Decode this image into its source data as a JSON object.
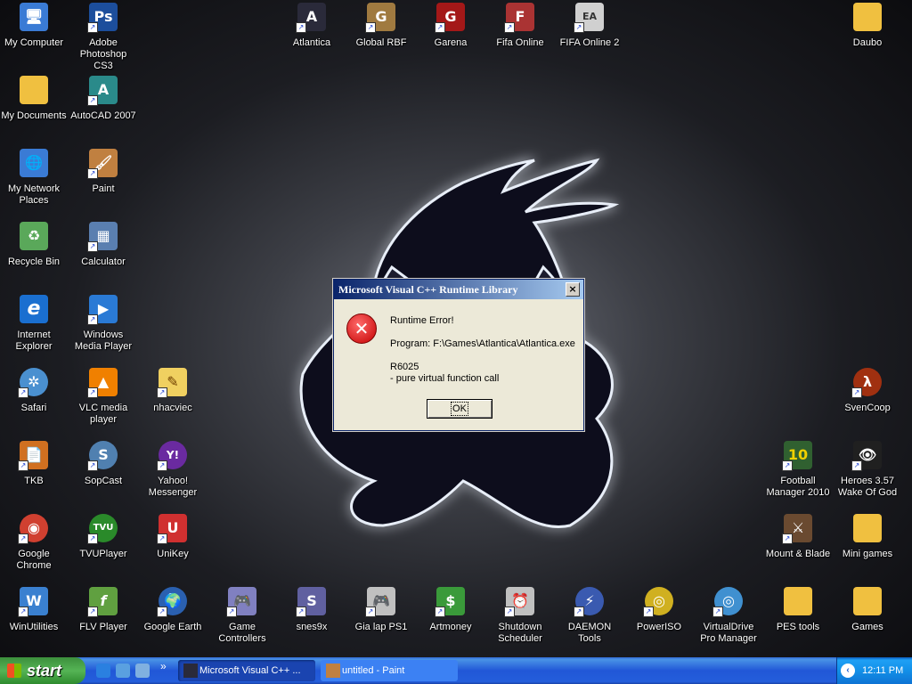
{
  "desktop": {
    "icons": [
      {
        "label": "My Computer",
        "icon": "my-computer-icon",
        "color": "#3a7bd5",
        "glyph": "🖥"
      },
      {
        "label": "Adobe Photoshop CS3",
        "icon": "photoshop-icon",
        "color": "#1c4e9c",
        "glyph": "Ps"
      },
      {
        "label": "Atlantica",
        "icon": "atlantica-icon",
        "color": "#2a2a3a",
        "glyph": "A"
      },
      {
        "label": "Global RBF",
        "icon": "global-rbf-icon",
        "color": "#a07a40",
        "glyph": "G"
      },
      {
        "label": "Garena",
        "icon": "garena-icon",
        "color": "#a41818",
        "glyph": "G"
      },
      {
        "label": "Fifa Online",
        "icon": "fifa-online-icon",
        "color": "#aa3333",
        "glyph": "F"
      },
      {
        "label": "FIFA Online 2",
        "icon": "fifa-online-2-icon",
        "color": "#d0d0d0",
        "glyph": "EA"
      },
      {
        "label": "Daubo",
        "icon": "folder-icon",
        "color": "#f0c040",
        "glyph": ""
      },
      {
        "label": "My Documents",
        "icon": "my-documents-icon",
        "color": "#f0c040",
        "glyph": ""
      },
      {
        "label": "AutoCAD 2007",
        "icon": "autocad-icon",
        "color": "#2a8a8a",
        "glyph": "A"
      },
      {
        "label": "My Network Places",
        "icon": "network-places-icon",
        "color": "#3a7bd5",
        "glyph": "🌐"
      },
      {
        "label": "Paint",
        "icon": "paint-icon",
        "color": "#c08040",
        "glyph": "🖌"
      },
      {
        "label": "Recycle Bin",
        "icon": "recycle-bin-icon",
        "color": "#5aa85a",
        "glyph": "♻"
      },
      {
        "label": "Calculator",
        "icon": "calculator-icon",
        "color": "#5a7fb0",
        "glyph": "▦"
      },
      {
        "label": "Internet Explorer",
        "icon": "internet-explorer-icon",
        "color": "#1a6fd0",
        "glyph": "e"
      },
      {
        "label": "Windows Media Player",
        "icon": "media-player-icon",
        "color": "#2a7ad5",
        "glyph": "▶"
      },
      {
        "label": "Safari",
        "icon": "safari-icon",
        "color": "#4a90d0",
        "glyph": "✲"
      },
      {
        "label": "VLC media player",
        "icon": "vlc-icon",
        "color": "#f08000",
        "glyph": "▲"
      },
      {
        "label": "nhacviec",
        "icon": "note-icon",
        "color": "#f0d060",
        "glyph": "✎"
      },
      {
        "label": "SvenCoop",
        "icon": "svencoop-icon",
        "color": "#a03010",
        "glyph": "λ"
      },
      {
        "label": "TKB",
        "icon": "tkb-icon",
        "color": "#d07020",
        "glyph": "📄"
      },
      {
        "label": "SopCast",
        "icon": "sopcast-icon",
        "color": "#5080b0",
        "glyph": "S"
      },
      {
        "label": "Yahoo! Messenger",
        "icon": "yahoo-messenger-icon",
        "color": "#6a2aa0",
        "glyph": "Y!"
      },
      {
        "label": "Football Manager 2010",
        "icon": "football-manager-icon",
        "color": "#306030",
        "glyph": "10"
      },
      {
        "label": "Heroes 3.57 Wake Of God",
        "icon": "heroes-icon",
        "color": "#202020",
        "glyph": "👁"
      },
      {
        "label": "Google Chrome",
        "icon": "chrome-icon",
        "color": "#d04030",
        "glyph": "◉"
      },
      {
        "label": "TVUPlayer",
        "icon": "tvu-player-icon",
        "color": "#2a8a2a",
        "glyph": "TVU"
      },
      {
        "label": "UniKey",
        "icon": "unikey-icon",
        "color": "#d03030",
        "glyph": "U"
      },
      {
        "label": "Mount & Blade",
        "icon": "mount-blade-icon",
        "color": "#6a4a30",
        "glyph": "⚔"
      },
      {
        "label": "Mini games",
        "icon": "folder-icon",
        "color": "#f0c040",
        "glyph": ""
      },
      {
        "label": "WinUtilities",
        "icon": "winutilities-icon",
        "color": "#3a80d0",
        "glyph": "W"
      },
      {
        "label": "FLV Player",
        "icon": "flv-player-icon",
        "color": "#60a040",
        "glyph": "f"
      },
      {
        "label": "Google Earth",
        "icon": "google-earth-icon",
        "color": "#2a60b0",
        "glyph": "🌍"
      },
      {
        "label": "Game Controllers",
        "icon": "game-controllers-icon",
        "color": "#8080c0",
        "glyph": "🎮"
      },
      {
        "label": "snes9x",
        "icon": "snes9x-icon",
        "color": "#6060a0",
        "glyph": "S"
      },
      {
        "label": "Gia lap PS1",
        "icon": "ps1-icon",
        "color": "#c0c0c0",
        "glyph": "🎮"
      },
      {
        "label": "Artmoney",
        "icon": "artmoney-icon",
        "color": "#3a9a3a",
        "glyph": "$"
      },
      {
        "label": "Shutdown Scheduler",
        "icon": "shutdown-scheduler-icon",
        "color": "#c0c0c0",
        "glyph": "⏰"
      },
      {
        "label": "DAEMON Tools",
        "icon": "daemon-tools-icon",
        "color": "#3a5ab0",
        "glyph": "⚡"
      },
      {
        "label": "PowerISO",
        "icon": "poweriso-icon",
        "color": "#d0b020",
        "glyph": "◎"
      },
      {
        "label": "VirtualDrive Pro Manager",
        "icon": "virtualdrive-icon",
        "color": "#4090d0",
        "glyph": "◎"
      },
      {
        "label": "PES tools",
        "icon": "folder-icon",
        "color": "#f0c040",
        "glyph": ""
      },
      {
        "label": "Games",
        "icon": "folder-icon",
        "color": "#f0c040",
        "glyph": ""
      }
    ]
  },
  "dialog": {
    "title": "Microsoft Visual C++ Runtime Library",
    "close_label": "×",
    "lines": [
      "Runtime Error!",
      "Program: F:\\Games\\Atlantica\\Atlantica.exe",
      "R6025",
      "- pure virtual function call"
    ],
    "ok_label": "OK",
    "icon": "error-icon"
  },
  "taskbar": {
    "start_label": "start",
    "quick_launch": [
      {
        "icon": "internet-explorer-icon",
        "color": "#2a80e0"
      },
      {
        "icon": "media-player-icon",
        "color": "#5aa0e0"
      },
      {
        "icon": "show-desktop-icon",
        "color": "#80b0e0"
      }
    ],
    "chevron": "»",
    "tasks": [
      {
        "label": "Microsoft Visual C++ ...",
        "icon": "atlantica-icon",
        "active": true
      },
      {
        "label": "untitled - Paint",
        "icon": "paint-icon",
        "active": false
      }
    ],
    "clock": "12:11 PM",
    "tray_expand": "‹"
  }
}
